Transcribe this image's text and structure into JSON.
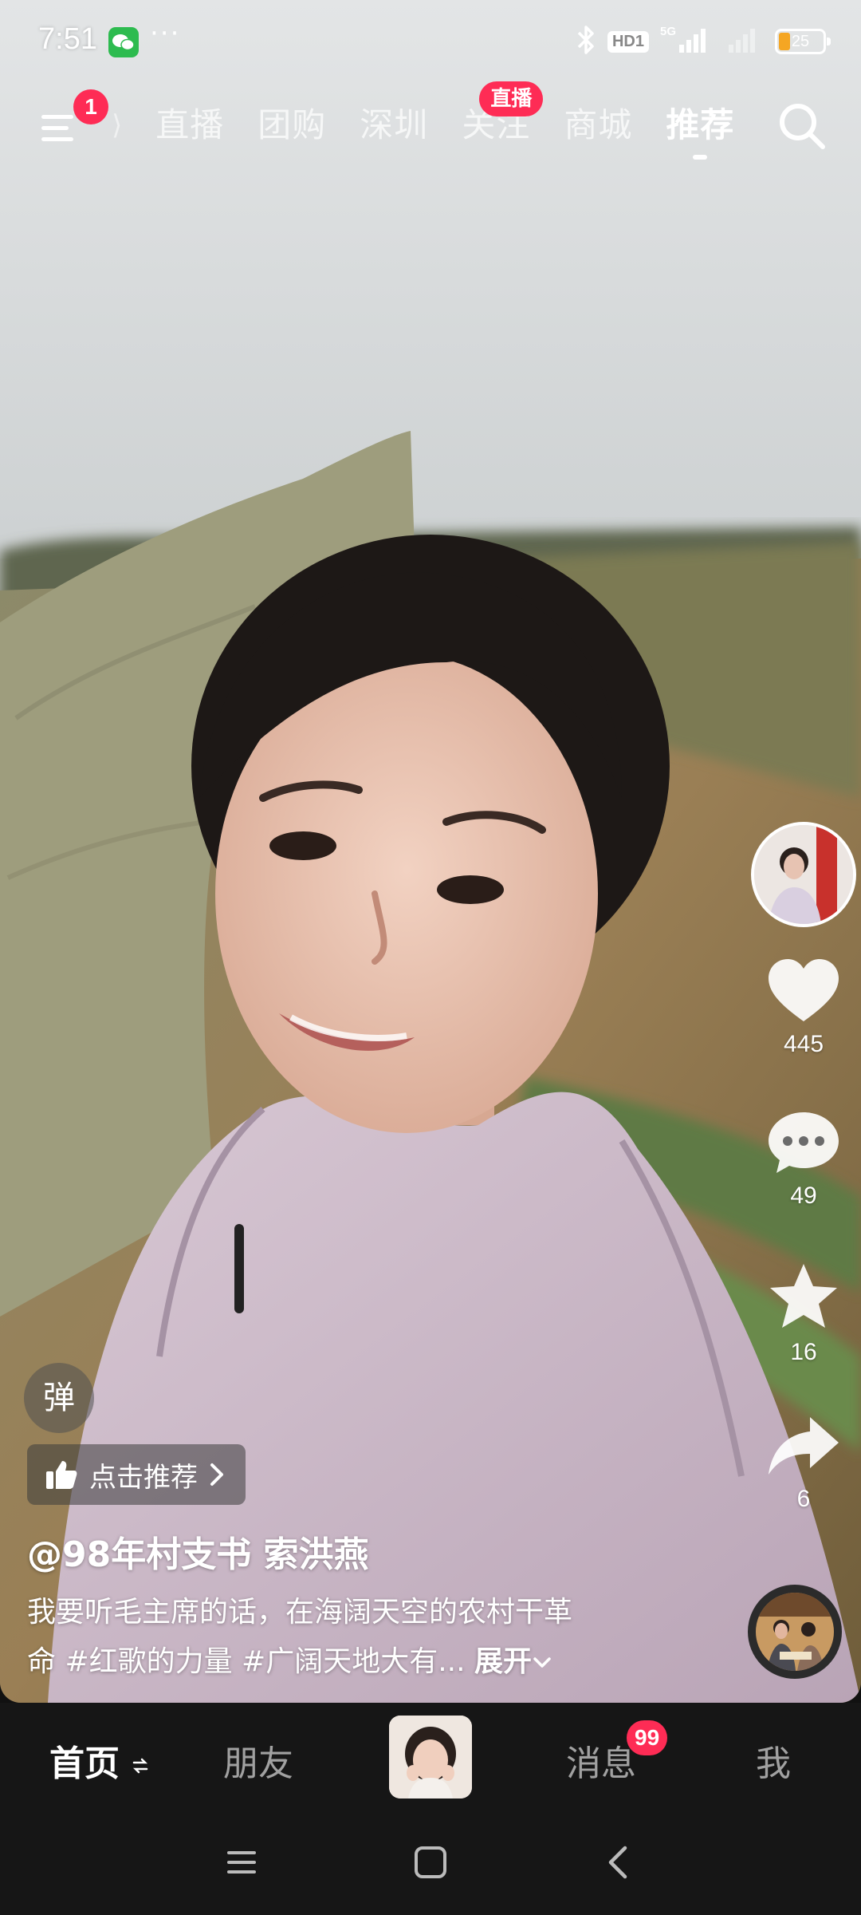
{
  "status_bar": {
    "time": "7:51",
    "more": "···",
    "hd_label": "HD1",
    "network_label": "5G",
    "battery_level": "25",
    "icons": [
      "wechat-icon",
      "bluetooth-icon",
      "signal-icon",
      "battery-icon"
    ]
  },
  "top_nav": {
    "menu_badge": "1",
    "tabs": [
      {
        "label": "直播"
      },
      {
        "label": "团购"
      },
      {
        "label": "深圳"
      },
      {
        "label": "关注",
        "badge": "直播"
      },
      {
        "label": "商城"
      },
      {
        "label": "推荐",
        "active": true
      }
    ]
  },
  "side_actions": {
    "like_count": "445",
    "comment_count": "49",
    "favorite_count": "16",
    "share_count": "6"
  },
  "video_info": {
    "danmaku_label": "弹",
    "recommend_label": "点击推荐",
    "author": "@98年村支书 索洪燕",
    "caption_line1": "我要听毛主席的话，在海阔天空的农村干革",
    "caption_line2": "命 #红歌的力量 #广阔天地大有...",
    "expand_label": "展开"
  },
  "bottom_tabs": {
    "home": "首页",
    "friends": "朋友",
    "messages": "消息",
    "messages_badge": "99",
    "me": "我"
  },
  "colors": {
    "accent": "#fe2c55",
    "tab_bar_bg": "#161616",
    "battery": "#f5a623",
    "wechat": "#2dbb4f"
  }
}
